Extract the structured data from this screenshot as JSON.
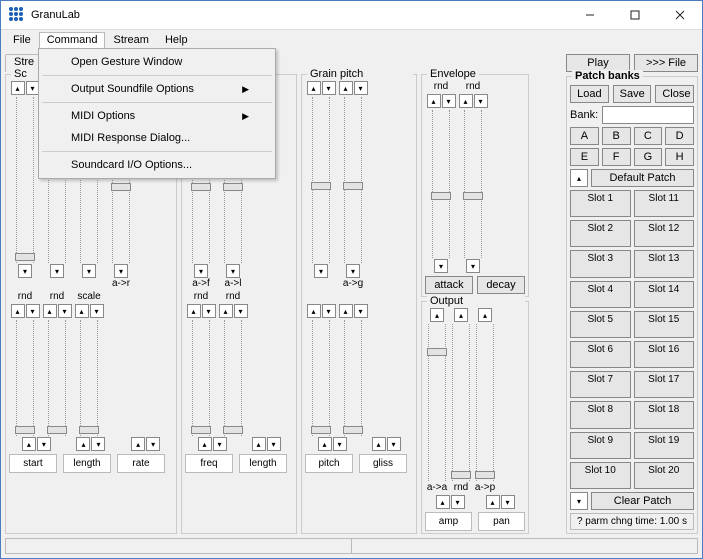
{
  "app": {
    "title": "GranuLab"
  },
  "menus": {
    "file": "File",
    "command": "Command",
    "stream": "Stream",
    "help": "Help"
  },
  "command_menu": {
    "open_gesture": "Open Gesture Window",
    "output_soundfile": "Output Soundfile Options",
    "midi_options": "MIDI Options",
    "midi_response": "MIDI Response Dialog...",
    "soundcard_io": "Soundcard I/O Options..."
  },
  "tabs": {
    "stream": "Stre"
  },
  "groups": {
    "sound": {
      "title": "Sc",
      "a_r": "a->r",
      "row2_labels": {
        "rnd1": "rnd",
        "rnd2": "rnd",
        "scale": "scale"
      },
      "footers": {
        "start": "start",
        "length": "length",
        "rate": "rate"
      }
    },
    "grain": {
      "title": "",
      "a_f": "a->f",
      "a_l": "a->l",
      "row2_labels": {
        "rnd1": "rnd",
        "rnd2": "rnd"
      },
      "footers": {
        "freq": "freq",
        "length": "length"
      }
    },
    "pitch": {
      "title": "Grain pitch",
      "a_g": "a->g",
      "footers": {
        "pitch": "pitch",
        "gliss": "gliss"
      }
    },
    "env": {
      "title": "Envelope",
      "rnd1": "rnd",
      "rnd2": "rnd",
      "attack": "attack",
      "decay": "decay"
    },
    "output": {
      "title": "Output",
      "a_a": "a->a",
      "rnd": "rnd",
      "a_p": "a->p",
      "footers": {
        "amp": "amp",
        "pan": "pan"
      }
    }
  },
  "right": {
    "play": "Play",
    "to_file": ">>> File",
    "patch_banks": "Patch banks",
    "load": "Load",
    "save": "Save",
    "close": "Close",
    "bank_label": "Bank:",
    "letters": [
      "A",
      "B",
      "C",
      "D",
      "E",
      "F",
      "G",
      "H"
    ],
    "default_patch": "Default Patch",
    "slots": [
      "Slot 1",
      "Slot 11",
      "Slot 2",
      "Slot 12",
      "Slot 3",
      "Slot 13",
      "Slot 4",
      "Slot 14",
      "Slot 5",
      "Slot 15",
      "Slot 6",
      "Slot 16",
      "Slot 7",
      "Slot 17",
      "Slot 8",
      "Slot 18",
      "Slot 9",
      "Slot 19",
      "Slot 10",
      "Slot 20"
    ],
    "clear": "Clear Patch",
    "parm": "? parm chng time:  1.00 s"
  }
}
